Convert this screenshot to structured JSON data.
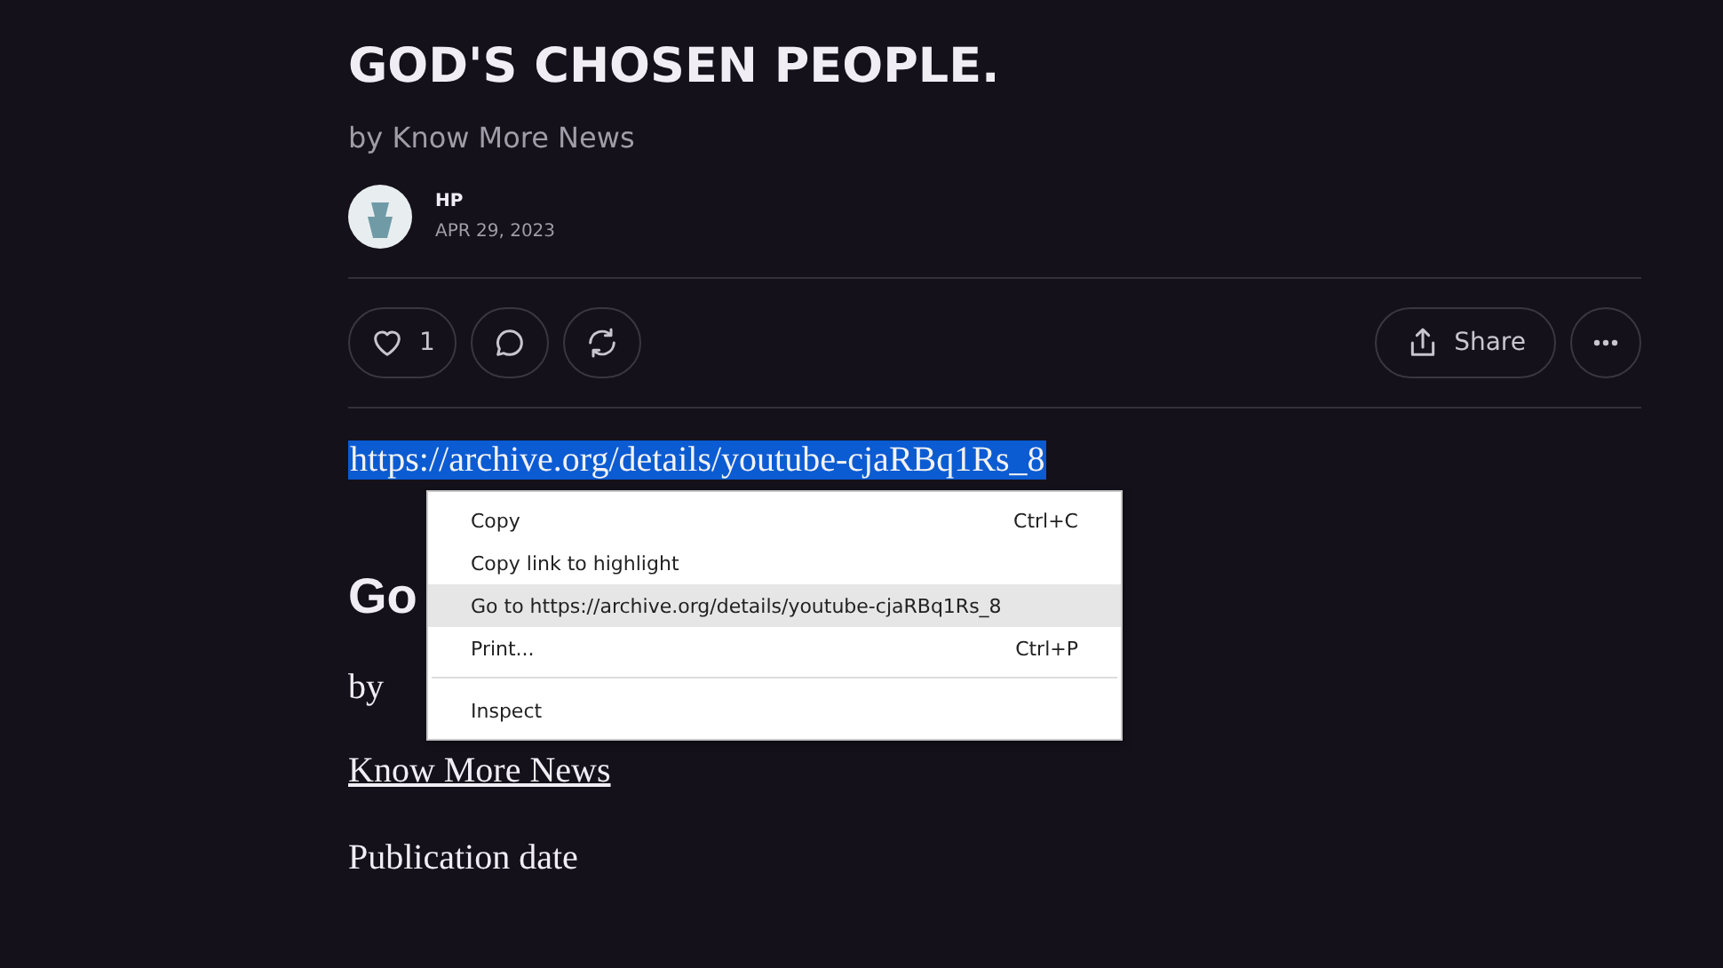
{
  "post": {
    "title": "GOD'S CHOSEN PEOPLE.",
    "byline": "by Know More News",
    "author": {
      "name": "HP",
      "date": "APR 29, 2023"
    }
  },
  "actions": {
    "like_count": "1",
    "share_label": "Share"
  },
  "body": {
    "link": {
      "text": "https://archive.org/details/youtube-cjaRBq1Rs_8",
      "selected": true
    },
    "heading": "Go",
    "by": "by",
    "source_link": "Know More News",
    "date_label": "Publication date"
  },
  "context_menu": {
    "items": [
      {
        "kind": "item",
        "label": "Copy",
        "shortcut": "Ctrl+C",
        "selected": false
      },
      {
        "kind": "item",
        "label": "Copy link to highlight",
        "selected": false
      },
      {
        "kind": "item",
        "label": "Go to https://archive.org/details/youtube-cjaRBq1Rs_8",
        "selected": true
      },
      {
        "kind": "item",
        "label": "Print...",
        "shortcut": "Ctrl+P",
        "selected": false
      },
      {
        "kind": "separator"
      },
      {
        "kind": "item",
        "label": "Inspect",
        "selected": false
      }
    ]
  }
}
